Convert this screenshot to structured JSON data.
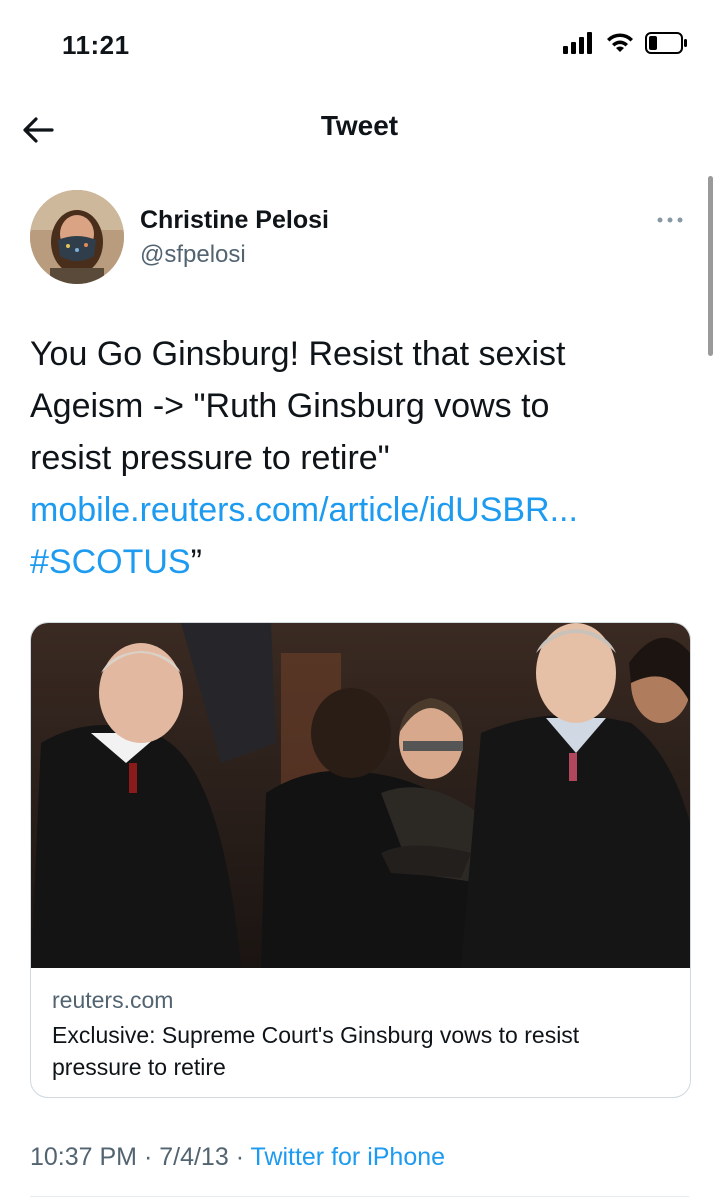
{
  "status_bar": {
    "time": "11:21"
  },
  "nav": {
    "title": "Tweet"
  },
  "author": {
    "name": "Christine Pelosi",
    "handle": "@sfpelosi"
  },
  "tweet": {
    "line1": "You Go Ginsburg! Resist that sexist",
    "line2": "Ageism -> \"Ruth Ginsburg vows to",
    "line3": "resist pressure to retire\"",
    "link": "mobile.reuters.com/article/idUSBR...",
    "hashtag": "#SCOTUS",
    "hashtag_suffix": "”"
  },
  "card": {
    "domain": "reuters.com",
    "title": "Exclusive: Supreme Court's Ginsburg vows to resist pressure to retire"
  },
  "meta": {
    "time": "10:37 PM",
    "sep1": " · ",
    "date": "7/4/13",
    "sep2": " · ",
    "source": "Twitter for iPhone"
  },
  "colors": {
    "link": "#1d9bf0",
    "secondary_text": "#536471",
    "border": "#cfd9de"
  },
  "icons": [
    "signal-icon",
    "wifi-icon",
    "battery-icon",
    "back-arrow-icon",
    "more-options-icon"
  ]
}
